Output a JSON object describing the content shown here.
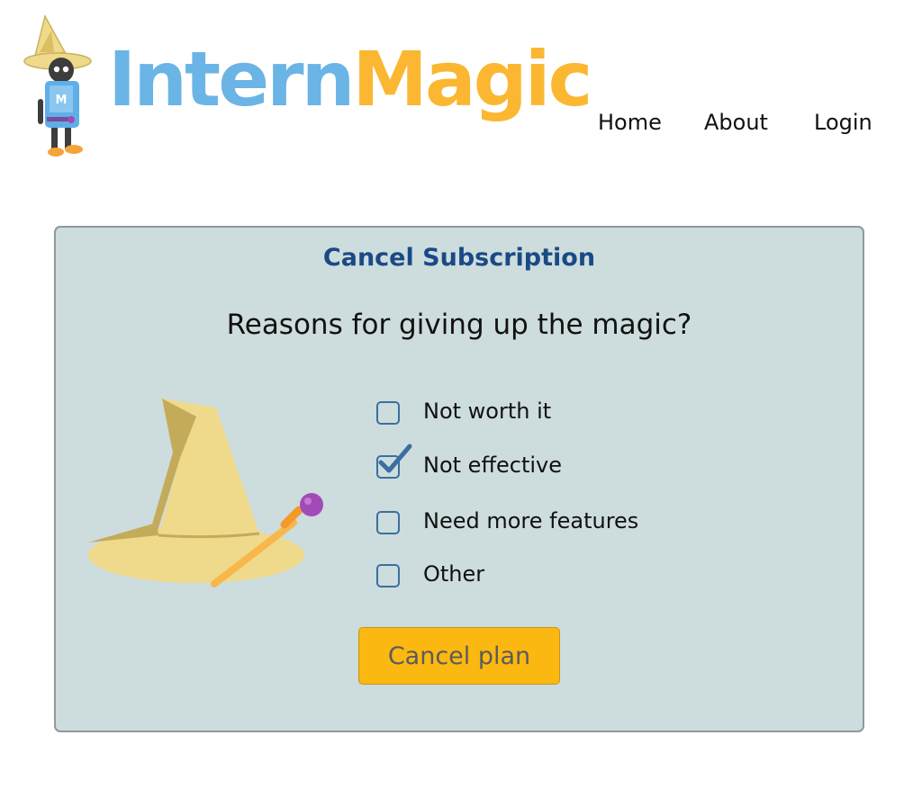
{
  "header": {
    "logo": {
      "text_part1": "Intern",
      "text_part2": "Magic",
      "mascot_letter": "M",
      "colors": {
        "blue": "#6ab4e6",
        "orange": "#fbb731"
      }
    },
    "nav": [
      {
        "label": "Home"
      },
      {
        "label": "About"
      },
      {
        "label": "Login"
      }
    ]
  },
  "card": {
    "title": "Cancel Subscription",
    "question": "Reasons for giving up the magic?",
    "illustration": "wizard-hat-and-wand",
    "options": [
      {
        "label": "Not worth it",
        "checked": false
      },
      {
        "label": "Not effective",
        "checked": true
      },
      {
        "label": "Need more features",
        "checked": false
      },
      {
        "label": "Other",
        "checked": false
      }
    ],
    "cancel_button_label": "Cancel plan",
    "colors": {
      "background": "#cddcdd",
      "title": "#1a4a85",
      "checkbox": "#3a6fa0",
      "button": "#fbb810"
    }
  }
}
